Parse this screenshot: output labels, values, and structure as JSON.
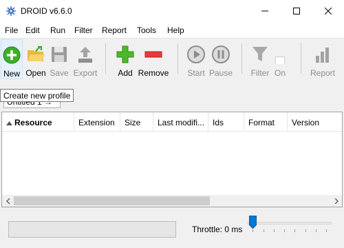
{
  "window": {
    "title": "DROID v6.6.0"
  },
  "menu": [
    "File",
    "Edit",
    "Run",
    "Filter",
    "Report",
    "Tools",
    "Help"
  ],
  "toolbar": {
    "new": "New",
    "open": "Open",
    "save": "Save",
    "export": "Export",
    "add": "Add",
    "remove": "Remove",
    "start": "Start",
    "pause": "Pause",
    "filter": "Filter",
    "filter_on": "On",
    "report": "Report"
  },
  "tooltip": "Create new profile",
  "profile_tab": {
    "label": "Untitled 1 →"
  },
  "table": {
    "columns": [
      "Resource",
      "Extension",
      "Size",
      "Last modifi...",
      "Ids",
      "Format",
      "Version"
    ],
    "sorted_column": "Resource",
    "rows": []
  },
  "status": {
    "progress": 0,
    "throttle_label": "Throttle: 0 ms",
    "throttle_value_ms": 0
  }
}
